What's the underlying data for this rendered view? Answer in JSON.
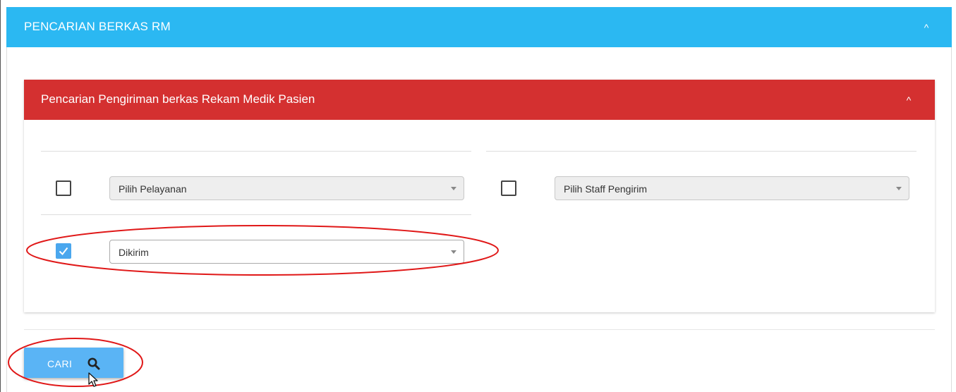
{
  "outer_panel": {
    "title": "PENCARIAN BERKAS RM",
    "collapse_glyph": "^",
    "color": "#2bb8f2"
  },
  "inner_panel": {
    "title": "Pencarian Pengiriman berkas Rekam Medik Pasien",
    "collapse_glyph": "^",
    "color": "#d43030"
  },
  "filters": {
    "layanan": {
      "checked": false,
      "selected": "Pilih Pelayanan"
    },
    "staff": {
      "checked": false,
      "selected": "Pilih Staff Pengirim"
    },
    "status": {
      "checked": true,
      "selected": "Dikirim",
      "check_color": "#4aa7ee"
    }
  },
  "actions": {
    "search_label": "CARI",
    "search_icon": "search-icon",
    "button_color": "#5ab4f5"
  },
  "annotation_color": "#e01818"
}
